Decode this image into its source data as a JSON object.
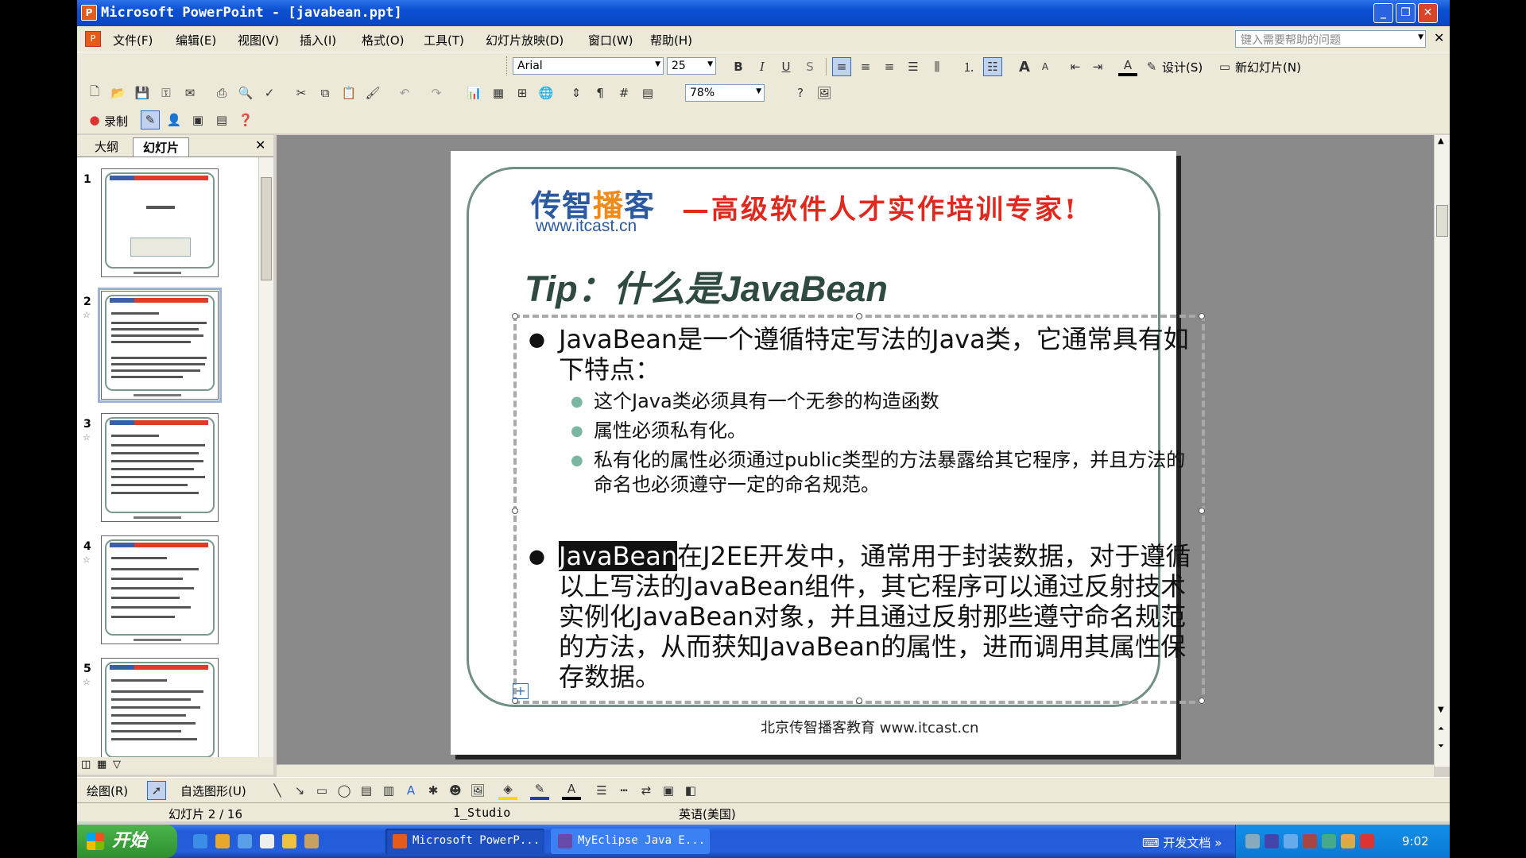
{
  "window": {
    "title": "Microsoft PowerPoint - [javabean.ppt]",
    "app_icon": "powerpoint-icon",
    "controls": [
      "minimize",
      "restore",
      "close"
    ]
  },
  "menubar": {
    "items": [
      "文件(F)",
      "编辑(E)",
      "视图(V)",
      "插入(I)",
      "格式(O)",
      "工具(T)",
      "幻灯片放映(D)",
      "窗口(W)",
      "帮助(H)"
    ],
    "help_placeholder": "键入需要帮助的问题"
  },
  "format_toolbar": {
    "font": "Arial",
    "font_size": "25",
    "design_label": "设计(S)",
    "new_slide_label": "新幻灯片(N)"
  },
  "standard_toolbar": {
    "zoom": "78%"
  },
  "review_toolbar": {
    "record_label": "录制"
  },
  "left_pane": {
    "tabs": [
      "大纲",
      "幻灯片"
    ],
    "active_tab": "幻灯片",
    "thumbnails": [
      "1",
      "2",
      "3",
      "4",
      "5"
    ],
    "selected": 2
  },
  "slide": {
    "logo_part1": "传智",
    "logo_part2": "播",
    "logo_part3": "客",
    "logo_url": "www.itcast.cn",
    "slogan": "—高级软件人才实作培训专家!",
    "title": "Tip：什么是JavaBean",
    "bullet1": "JavaBean是一个遵循特定写法的Java类，它通常具有如下特点：",
    "sub_bullets": [
      "这个Java类必须具有一个无参的构造函数",
      "属性必须私有化。",
      "私有化的属性必须通过public类型的方法暴露给其它程序，并且方法的命名也必须遵守一定的命名规范。"
    ],
    "bullet2_highlight": "JavaBean",
    "bullet2_rest": "在J2EE开发中，通常用于封装数据，对于遵循以上写法的JavaBean组件，其它程序可以通过反射技术实例化JavaBean对象，并且通过反射那些遵守命名规范的方法，从而获知JavaBean的属性，进而调用其属性保存数据。",
    "footer": "北京传智播客教育 www.itcast.cn",
    "accent_red": "#e0281e",
    "accent_blue": "#2c5aa0",
    "frame_color": "#6f8f82"
  },
  "drawing_toolbar": {
    "draw_label": "绘图(R)",
    "autoshape_label": "自选图形(U)"
  },
  "statusbar": {
    "slide_pos": "幻灯片 2 / 16",
    "design": "1_Studio",
    "language": "英语(美国)"
  },
  "taskbar": {
    "start_label": "开始",
    "tasks": [
      "Microsoft PowerP...",
      "MyEclipse Java E..."
    ],
    "dev_docs": "开发文档",
    "clock": "9:02"
  }
}
